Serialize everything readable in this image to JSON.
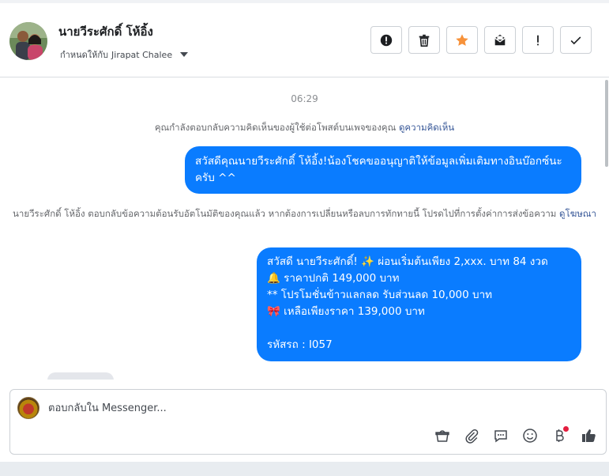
{
  "header": {
    "name": "นายวีระศักดิ์ โห้อิ้ง",
    "assign_prefix": "กำหนดให้กับ",
    "assignee": "Jirapat Chalee"
  },
  "actions": [
    {
      "name": "mark-spam-icon"
    },
    {
      "name": "trash-icon"
    },
    {
      "name": "star-icon",
      "color": "#f7923a"
    },
    {
      "name": "mark-unread-icon"
    },
    {
      "name": "important-icon"
    },
    {
      "name": "done-check-icon"
    }
  ],
  "conversation": {
    "time": "06:29",
    "system_1": "คุณกำลังตอบกลับความคิดเห็นของผู้ใช้ต่อโพสต์บนเพจของคุณ",
    "system_1_link": "ดูความคิดเห็น",
    "message_1": "สวัสดีคุณนายวีระศักดิ์ โห้อิ้ง!น้องโชคขออนุญาติให้ข้อมูลเพิ่มเติมทางอินบ๊อกซ์นะครับ ^^",
    "system_2": "นายวีระศักดิ์ โห้อิ้ง ตอบกลับข้อความต้อนรับอัตโนมัติของคุณแล้ว หากต้องการเปลี่ยนหรือลบการทักทายนี้ โปรดไปที่การตั้งค่าการส่งข้อความ",
    "system_2_link": "ดูโฆษณา",
    "message_2": {
      "line1": "สวัสดี นายวีระศักดิ์! ✨  ผ่อนเริ่มต้นเพียง 2,xxx. บาท 84 งวด",
      "line2": "🔔 ราคาปกติ 149,000 บาท",
      "line3": "** โปรโมชั่นข้าวแลกลด รับส่วนลด 10,000 บาท",
      "line4": "🎀  เหลือเพียงราคา 139,000 บาท",
      "line5": " รหัสรถ : I057"
    }
  },
  "composer": {
    "placeholder": "ตอบกลับใน Messenger...",
    "tools": [
      "shopping-bag-icon",
      "attachment-icon",
      "saved-replies-icon",
      "emoji-icon",
      "payment-icon",
      "like-icon"
    ]
  },
  "colors": {
    "bubble": "#0a7cff",
    "link": "#385898",
    "star": "#f7923a",
    "notification_dot": "#e41e3f"
  }
}
